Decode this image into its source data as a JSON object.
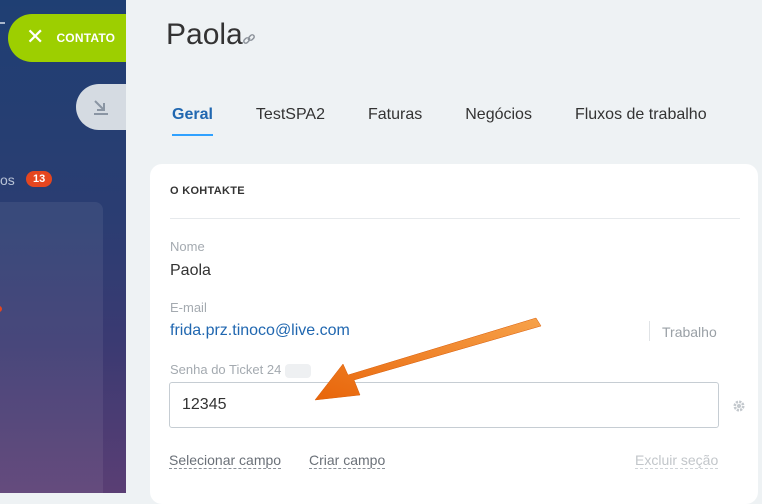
{
  "left": {
    "contact_button": "CONTATO",
    "section_partial": "os",
    "badge": "13"
  },
  "header": {
    "title": "Paola"
  },
  "tabs": [
    {
      "label": "Geral",
      "active": true
    },
    {
      "label": "TestSPA2"
    },
    {
      "label": "Faturas"
    },
    {
      "label": "Negócios"
    },
    {
      "label": "Fluxos de trabalho"
    }
  ],
  "section": {
    "title": "O KOHTAKTE",
    "fields": {
      "name": {
        "label": "Nome",
        "value": "Paola"
      },
      "email": {
        "label": "E-mail",
        "value": "frida.prz.tinoco@live.com",
        "type": "Trabalho"
      },
      "ticket": {
        "label": "Senha do Ticket 24",
        "value": "12345"
      }
    },
    "actions": {
      "select_field": "Selecionar campo",
      "create_field": "Criar campo",
      "delete_section": "Excluir seção"
    }
  },
  "colors": {
    "accent_green": "#9dcf00",
    "link_blue": "#2067b0",
    "badge_red": "#e5461f",
    "arrow_orange": "#f07a12"
  }
}
